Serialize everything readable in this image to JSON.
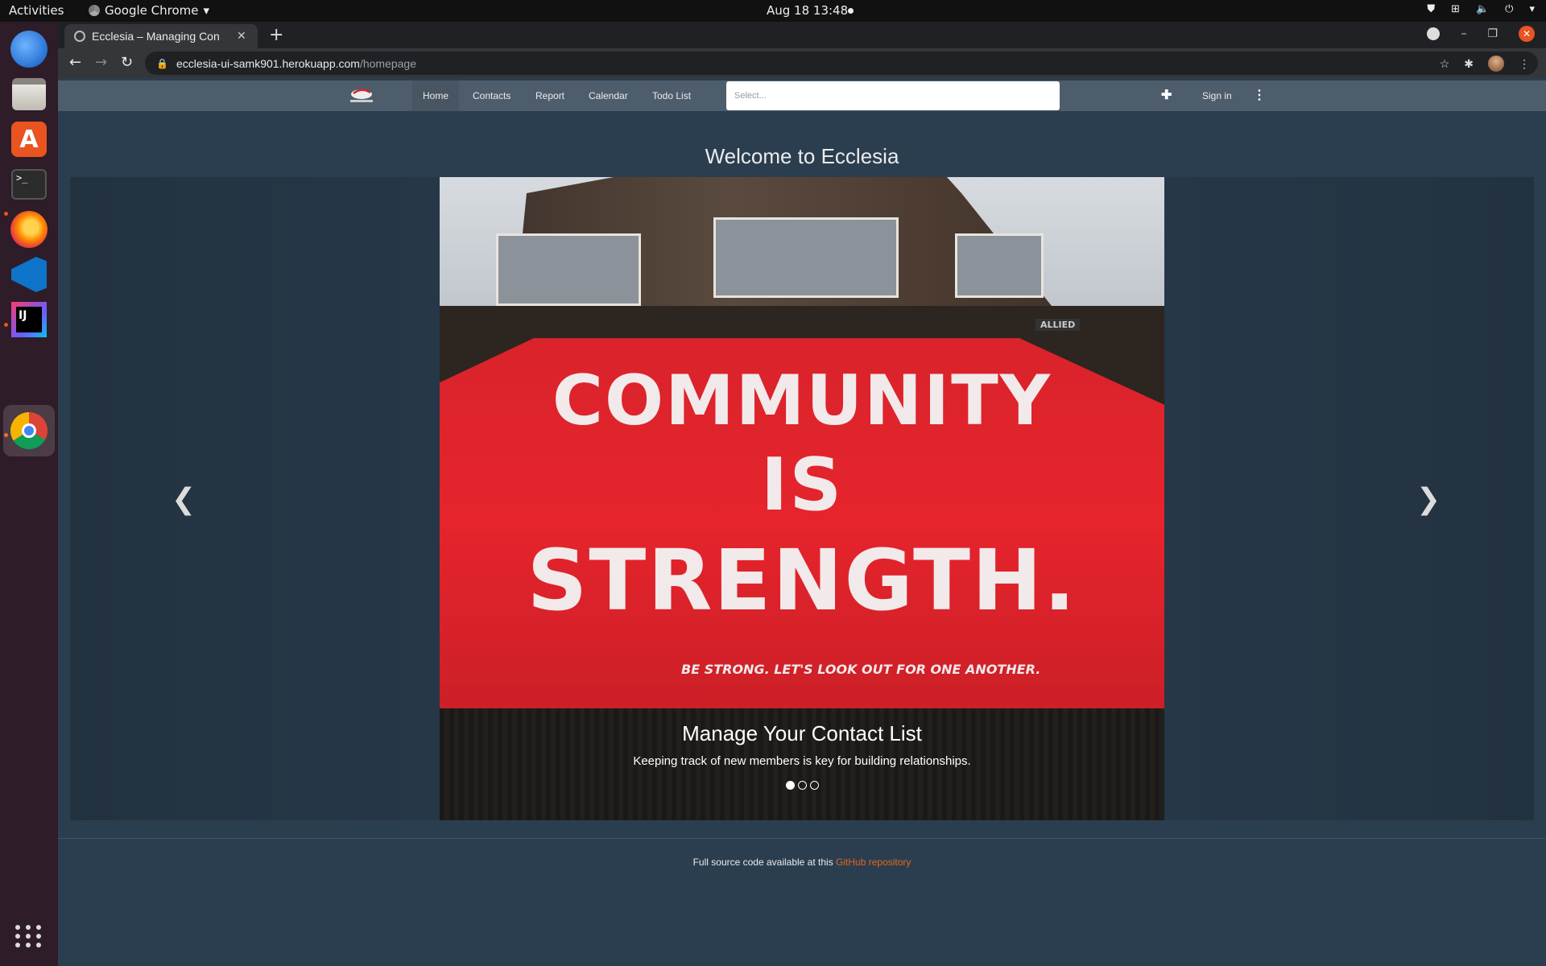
{
  "system": {
    "activities": "Activities",
    "app_name": "Google Chrome",
    "clock": "Aug 18  13:48"
  },
  "browser": {
    "tab_title": "Ecclesia – Managing Con",
    "url_host": "ecclesia-ui-samk901.herokuapp.com",
    "url_path": "/homepage"
  },
  "navbar": {
    "links": [
      "Home",
      "Contacts",
      "Report",
      "Calendar",
      "Todo List"
    ],
    "search_placeholder": "Select...",
    "signin": "Sign in"
  },
  "main": {
    "welcome": "Welcome to Ecclesia",
    "slide": {
      "line1": "COMMUNITY",
      "line2": "IS",
      "line3": "STRENGTH.",
      "tagline": "BE STRONG. LET'S LOOK OUT FOR ONE ANOTHER.",
      "sign": "ALLIED",
      "caption_title": "Manage Your Contact List",
      "caption_text": "Keeping track of new members is key for building relationships."
    },
    "slide_count": 3,
    "active_slide": 1
  },
  "footer": {
    "text": "Full source code available at this",
    "link": "GitHub repository"
  },
  "colors": {
    "page_bg": "#2b3e50",
    "navbar_bg": "#4e5d6c",
    "link_accent": "#df691a",
    "billboard_red": "#e6242c"
  }
}
